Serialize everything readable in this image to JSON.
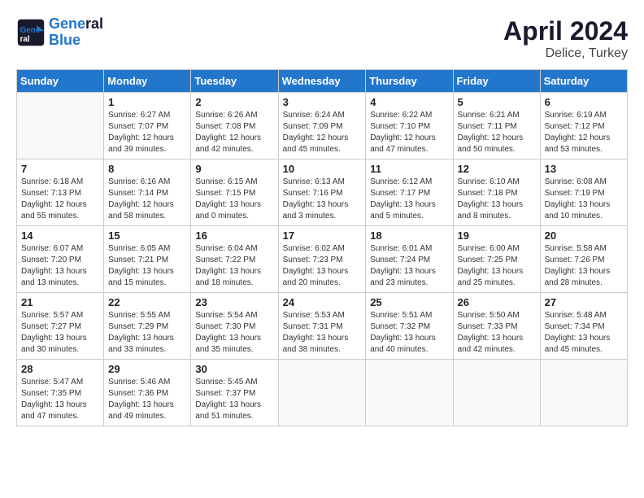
{
  "header": {
    "logo_line1": "General",
    "logo_line2": "Blue",
    "month_title": "April 2024",
    "subtitle": "Delice, Turkey"
  },
  "calendar": {
    "days_of_week": [
      "Sunday",
      "Monday",
      "Tuesday",
      "Wednesday",
      "Thursday",
      "Friday",
      "Saturday"
    ],
    "weeks": [
      [
        {
          "day": "",
          "info": ""
        },
        {
          "day": "1",
          "info": "Sunrise: 6:27 AM\nSunset: 7:07 PM\nDaylight: 12 hours\nand 39 minutes."
        },
        {
          "day": "2",
          "info": "Sunrise: 6:26 AM\nSunset: 7:08 PM\nDaylight: 12 hours\nand 42 minutes."
        },
        {
          "day": "3",
          "info": "Sunrise: 6:24 AM\nSunset: 7:09 PM\nDaylight: 12 hours\nand 45 minutes."
        },
        {
          "day": "4",
          "info": "Sunrise: 6:22 AM\nSunset: 7:10 PM\nDaylight: 12 hours\nand 47 minutes."
        },
        {
          "day": "5",
          "info": "Sunrise: 6:21 AM\nSunset: 7:11 PM\nDaylight: 12 hours\nand 50 minutes."
        },
        {
          "day": "6",
          "info": "Sunrise: 6:19 AM\nSunset: 7:12 PM\nDaylight: 12 hours\nand 53 minutes."
        }
      ],
      [
        {
          "day": "7",
          "info": "Sunrise: 6:18 AM\nSunset: 7:13 PM\nDaylight: 12 hours\nand 55 minutes."
        },
        {
          "day": "8",
          "info": "Sunrise: 6:16 AM\nSunset: 7:14 PM\nDaylight: 12 hours\nand 58 minutes."
        },
        {
          "day": "9",
          "info": "Sunrise: 6:15 AM\nSunset: 7:15 PM\nDaylight: 13 hours\nand 0 minutes."
        },
        {
          "day": "10",
          "info": "Sunrise: 6:13 AM\nSunset: 7:16 PM\nDaylight: 13 hours\nand 3 minutes."
        },
        {
          "day": "11",
          "info": "Sunrise: 6:12 AM\nSunset: 7:17 PM\nDaylight: 13 hours\nand 5 minutes."
        },
        {
          "day": "12",
          "info": "Sunrise: 6:10 AM\nSunset: 7:18 PM\nDaylight: 13 hours\nand 8 minutes."
        },
        {
          "day": "13",
          "info": "Sunrise: 6:08 AM\nSunset: 7:19 PM\nDaylight: 13 hours\nand 10 minutes."
        }
      ],
      [
        {
          "day": "14",
          "info": "Sunrise: 6:07 AM\nSunset: 7:20 PM\nDaylight: 13 hours\nand 13 minutes."
        },
        {
          "day": "15",
          "info": "Sunrise: 6:05 AM\nSunset: 7:21 PM\nDaylight: 13 hours\nand 15 minutes."
        },
        {
          "day": "16",
          "info": "Sunrise: 6:04 AM\nSunset: 7:22 PM\nDaylight: 13 hours\nand 18 minutes."
        },
        {
          "day": "17",
          "info": "Sunrise: 6:02 AM\nSunset: 7:23 PM\nDaylight: 13 hours\nand 20 minutes."
        },
        {
          "day": "18",
          "info": "Sunrise: 6:01 AM\nSunset: 7:24 PM\nDaylight: 13 hours\nand 23 minutes."
        },
        {
          "day": "19",
          "info": "Sunrise: 6:00 AM\nSunset: 7:25 PM\nDaylight: 13 hours\nand 25 minutes."
        },
        {
          "day": "20",
          "info": "Sunrise: 5:58 AM\nSunset: 7:26 PM\nDaylight: 13 hours\nand 28 minutes."
        }
      ],
      [
        {
          "day": "21",
          "info": "Sunrise: 5:57 AM\nSunset: 7:27 PM\nDaylight: 13 hours\nand 30 minutes."
        },
        {
          "day": "22",
          "info": "Sunrise: 5:55 AM\nSunset: 7:29 PM\nDaylight: 13 hours\nand 33 minutes."
        },
        {
          "day": "23",
          "info": "Sunrise: 5:54 AM\nSunset: 7:30 PM\nDaylight: 13 hours\nand 35 minutes."
        },
        {
          "day": "24",
          "info": "Sunrise: 5:53 AM\nSunset: 7:31 PM\nDaylight: 13 hours\nand 38 minutes."
        },
        {
          "day": "25",
          "info": "Sunrise: 5:51 AM\nSunset: 7:32 PM\nDaylight: 13 hours\nand 40 minutes."
        },
        {
          "day": "26",
          "info": "Sunrise: 5:50 AM\nSunset: 7:33 PM\nDaylight: 13 hours\nand 42 minutes."
        },
        {
          "day": "27",
          "info": "Sunrise: 5:48 AM\nSunset: 7:34 PM\nDaylight: 13 hours\nand 45 minutes."
        }
      ],
      [
        {
          "day": "28",
          "info": "Sunrise: 5:47 AM\nSunset: 7:35 PM\nDaylight: 13 hours\nand 47 minutes."
        },
        {
          "day": "29",
          "info": "Sunrise: 5:46 AM\nSunset: 7:36 PM\nDaylight: 13 hours\nand 49 minutes."
        },
        {
          "day": "30",
          "info": "Sunrise: 5:45 AM\nSunset: 7:37 PM\nDaylight: 13 hours\nand 51 minutes."
        },
        {
          "day": "",
          "info": ""
        },
        {
          "day": "",
          "info": ""
        },
        {
          "day": "",
          "info": ""
        },
        {
          "day": "",
          "info": ""
        }
      ]
    ]
  }
}
